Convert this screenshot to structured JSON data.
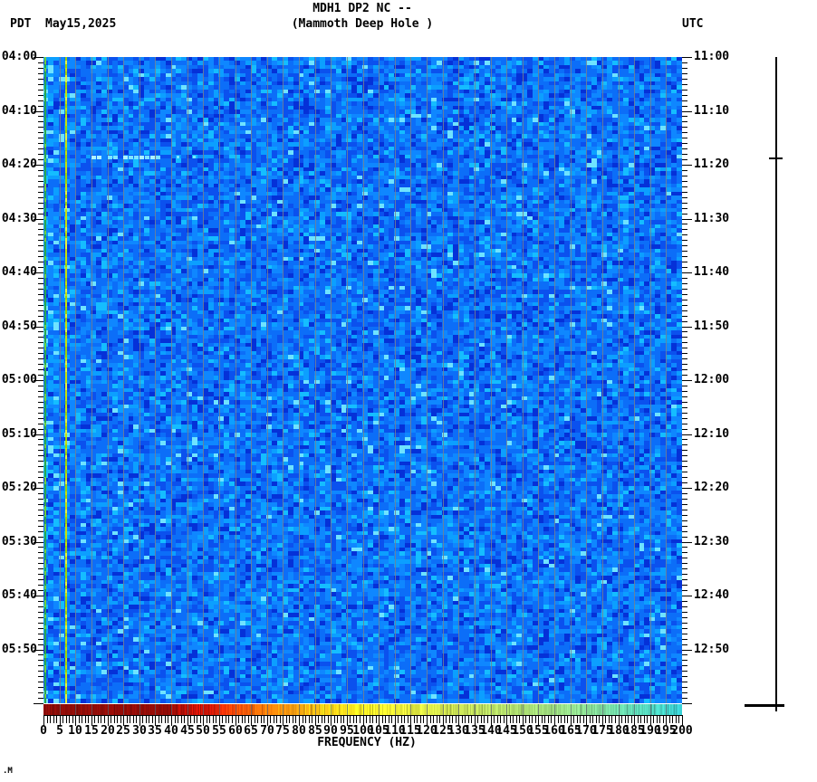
{
  "header": {
    "title": "MDH1 DP2 NC --",
    "subtitle": "(Mammoth Deep Hole )",
    "left_tz": "PDT",
    "date": "May15,2025",
    "right_tz": "UTC"
  },
  "y_axis_left": {
    "labels": [
      "04:00",
      "04:10",
      "04:20",
      "04:30",
      "04:40",
      "04:50",
      "05:00",
      "05:10",
      "05:20",
      "05:30",
      "05:40",
      "05:50"
    ]
  },
  "y_axis_right": {
    "labels": [
      "11:00",
      "11:10",
      "11:20",
      "11:30",
      "11:40",
      "11:50",
      "12:00",
      "12:10",
      "12:20",
      "12:30",
      "12:40",
      "12:50"
    ]
  },
  "x_axis": {
    "label": "FREQUENCY (HZ)",
    "tick_labels": [
      "0",
      "5",
      "10",
      "15",
      "20",
      "25",
      "30",
      "35",
      "40",
      "45",
      "50",
      "55",
      "60",
      "65",
      "70",
      "75",
      "80",
      "85",
      "90",
      "95",
      "100",
      "105",
      "110",
      "115",
      "120",
      "125",
      "130",
      "135",
      "140",
      "145",
      "150",
      "155",
      "160",
      "165",
      "170",
      "175",
      "180",
      "185",
      "190",
      "195",
      "200"
    ]
  },
  "watermark": ".M",
  "colors": {
    "background": "#ffffff",
    "tick": "#000000",
    "gridline": "#75808f",
    "edge_line": "#2aa74e",
    "edge_line_alt": "#6fcf3a",
    "narrowband_line": "#c6e207",
    "narrowband_alt1": "#9fd400",
    "narrowband_alt2": "#e6f43c",
    "streak": "#7fe5ff",
    "streak_bright": "#aef2ff",
    "noise_palette": [
      "#0531d8",
      "#0b51ee",
      "#0c6ef8",
      "#0f87ff",
      "#0c9fff",
      "#15bdff",
      "#6fe3ff"
    ]
  },
  "chart_data": {
    "type": "heatmap",
    "title": "MDH1 DP2 NC --",
    "subtitle": "(Mammoth Deep Hole )",
    "station": "MDH1 DP2 NC",
    "site_name": "Mammoth Deep Hole",
    "date": "May15,2025",
    "x": {
      "label": "FREQUENCY (HZ)",
      "min_hz": 0,
      "max_hz": 200,
      "major_tick_step_hz": 5,
      "minor_tick_step_hz": 1
    },
    "y_left": {
      "timezone": "PDT",
      "start": "04:00",
      "end": "06:00",
      "label_step_min": 10,
      "minor_tick_step_min": 1
    },
    "y_right": {
      "timezone": "UTC",
      "start": "11:00",
      "end": "13:00",
      "label_step_min": 10,
      "minor_tick_step_min": 1
    },
    "grid": {
      "vertical_lines_every_hz": 5,
      "color": "#75808f"
    },
    "background_field": "low-amplitude broadband noise rendered as a blue mosaic (dark blue to cyan speckle), uniform over the whole 2-hour window",
    "features": [
      {
        "kind": "persistent-narrowband-line",
        "freq_hz": 6.8,
        "color": "#c6e207",
        "note": "yellow-green vertical line spanning full time range"
      },
      {
        "kind": "edge-line",
        "freq_hz": 0.4,
        "color": "#2aa74e",
        "note": "green line at 0 Hz left edge spanning full time range"
      },
      {
        "kind": "transient-horizontal-streak",
        "time": "04:18",
        "minutes_after_start": 18.3,
        "freq_span_hz": [
          15,
          40
        ],
        "tail_to_hz": 53,
        "color": "#7fe5ff",
        "note": "bright cyan horizontal streak (small seismic event)"
      }
    ],
    "amplitude_strip": {
      "description": "mean amplitude vs frequency strip under the spectrogram; dark red at low frequency grading through red, orange, yellow, yellow-green, green to cyan at 200 Hz, with fine vertical striping",
      "stops": [
        [
          0,
          "#8d0d08"
        ],
        [
          40,
          "#930b06"
        ],
        [
          46,
          "#b80f05"
        ],
        [
          52,
          "#d81505"
        ],
        [
          58,
          "#ee3a05"
        ],
        [
          66,
          "#f86908"
        ],
        [
          74,
          "#fb8d0c"
        ],
        [
          82,
          "#fcae12"
        ],
        [
          90,
          "#fdd318"
        ],
        [
          98,
          "#fbe81e"
        ],
        [
          106,
          "#f2ec2c"
        ],
        [
          116,
          "#e0e83e"
        ],
        [
          126,
          "#cfe24e"
        ],
        [
          136,
          "#bfdf5e"
        ],
        [
          148,
          "#aede6f"
        ],
        [
          160,
          "#9cdc80"
        ],
        [
          172,
          "#85da95"
        ],
        [
          184,
          "#62d8b2"
        ],
        [
          194,
          "#45d6c8"
        ],
        [
          200,
          "#38d2d8"
        ]
      ]
    },
    "right_scale_bar": {
      "note": "thin vertical reference scale line at far right with a small tick near the 04:19 event time and a horizontal base bar at the bottom"
    }
  }
}
